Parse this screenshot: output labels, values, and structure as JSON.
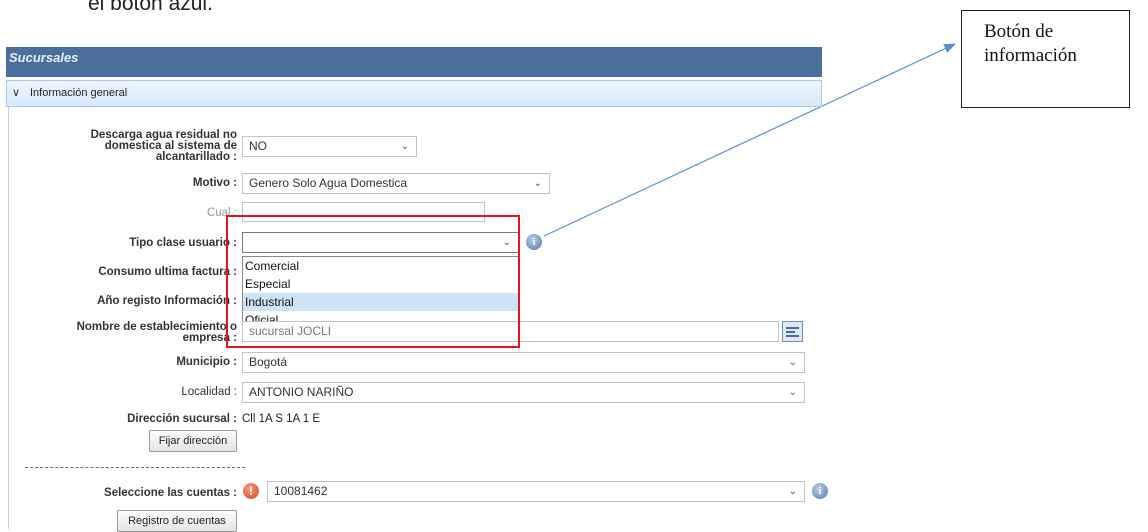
{
  "top_text": "el botón azul.",
  "callout": {
    "line1": "Botón de",
    "line2": "información"
  },
  "panel": {
    "title": "Sucursales"
  },
  "section": {
    "title": "Información general"
  },
  "form": {
    "descarga_label_1": "Descarga agua residual no",
    "descarga_label_2": "domestica al sistema de",
    "descarga_label_3": "alcantarillado :",
    "descarga_value": "NO",
    "motivo_label": "Motivo :",
    "motivo_value": "Genero Solo Agua Domestica",
    "cual_label": "Cual :",
    "cual_value": "",
    "tipo_label": "Tipo clase usuario :",
    "tipo_value": "",
    "tipo_options": [
      "Comercial",
      "Especial",
      "Industrial",
      "Oficial"
    ],
    "tipo_selected": "Industrial",
    "consumo_label": "Consumo ultima factura :",
    "anio_label": "Año registo Información :",
    "nombre_label_1": "Nombre de establecimiento o",
    "nombre_label_2": "empresa :",
    "nombre_value": "sucursal JOCLI",
    "municipio_label": "Municipio :",
    "municipio_value": "Bogotá",
    "localidad_label": "Localidad :",
    "localidad_value": "ANTONIO NARIÑO",
    "direccion_label": "Dirección sucursal :",
    "direccion_value": "Cll 1A S 1A 1 E",
    "fijar_button": "Fijar dirección",
    "cuentas_label": "Seleccione las cuentas :",
    "cuentas_value": "10081462",
    "registro_button": "Registro de cuentas"
  },
  "colors": {
    "header": "#4a6f9c",
    "highlight_box": "#e3141b",
    "selected_option": "#cfe3f7"
  }
}
